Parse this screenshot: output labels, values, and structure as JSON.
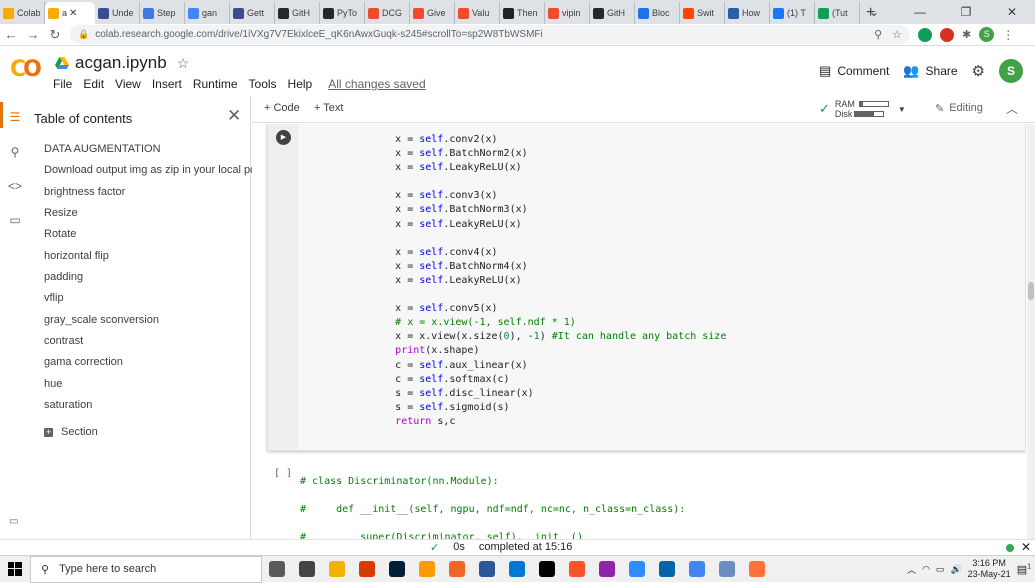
{
  "browser": {
    "tabs": [
      {
        "label": "Colab",
        "color": "#f9ab00"
      },
      {
        "label": "a",
        "color": "#f9ab00",
        "active": true
      },
      {
        "label": "Unde",
        "color": "#3d4b8f"
      },
      {
        "label": "Step",
        "color": "#3b78e7"
      },
      {
        "label": "gan",
        "color": "#4285f4"
      },
      {
        "label": "Gett",
        "color": "#3d4b8f"
      },
      {
        "label": "GitH",
        "color": "#24292e"
      },
      {
        "label": "PyTo",
        "color": "#24292e"
      },
      {
        "label": "DCG",
        "color": "#ee4c2c"
      },
      {
        "label": "Give",
        "color": "#ee4c2c"
      },
      {
        "label": "Valu",
        "color": "#ee4c2c"
      },
      {
        "label": "Then",
        "color": "#202124"
      },
      {
        "label": "vipin",
        "color": "#ee4c2c"
      },
      {
        "label": "GitH",
        "color": "#24292e"
      },
      {
        "label": "Bloc",
        "color": "#1a73e8"
      },
      {
        "label": "Swit",
        "color": "#ff4500"
      },
      {
        "label": "How",
        "color": "#2a5caa"
      },
      {
        "label": "(1) T",
        "color": "#1877f2"
      },
      {
        "label": "(Tut",
        "color": "#0f9d58"
      }
    ],
    "new_tab": "+",
    "url": "colab.research.google.com/drive/1iVXg7V7EkixlceE_qK6nAwxGuqk-s245#scrollTo=sp2W8TbWSMFi",
    "profile_initial": "S"
  },
  "colab": {
    "notebook_title": "acgan.ipynb",
    "menu": [
      "File",
      "Edit",
      "View",
      "Insert",
      "Runtime",
      "Tools",
      "Help"
    ],
    "saved_status": "All changes saved",
    "comment_label": "Comment",
    "share_label": "Share",
    "user_initial": "S"
  },
  "toc": {
    "title": "Table of contents",
    "items": [
      "DATA AUGMENTATION",
      "Download output img as zip in your local pc",
      "brightness factor",
      "Resize",
      "Rotate",
      "horizontal flip",
      "padding",
      "vflip",
      "gray_scale sconversion",
      "contrast",
      "gama correction",
      "hue",
      "saturation"
    ],
    "section_label": "Section"
  },
  "toolbar": {
    "add_code": "+ Code",
    "add_text": "+ Text",
    "ram_label": "RAM",
    "disk_label": "Disk",
    "ram_fill": 0.1,
    "disk_fill": 0.65,
    "editing_label": "Editing"
  },
  "cell2": {
    "run_label": "[ ]"
  },
  "status": {
    "check": "✓",
    "duration": "0s",
    "message": "completed at 15:16"
  },
  "taskbar": {
    "search_placeholder": "Type here to search",
    "time": "3:16 PM",
    "date": "23-May-21",
    "notification_count": "1",
    "apps": [
      "#5a5a5a",
      "#444",
      "#f0b400",
      "#d83b01",
      "#001e36",
      "#ff9a00",
      "#f16529",
      "#2b579a",
      "#0078d4",
      "#000",
      "#fb542b",
      "#8e24aa",
      "#2d8cff",
      "#0065a9",
      "#4285f4",
      "#6c8ebf",
      "#ff7139"
    ]
  }
}
